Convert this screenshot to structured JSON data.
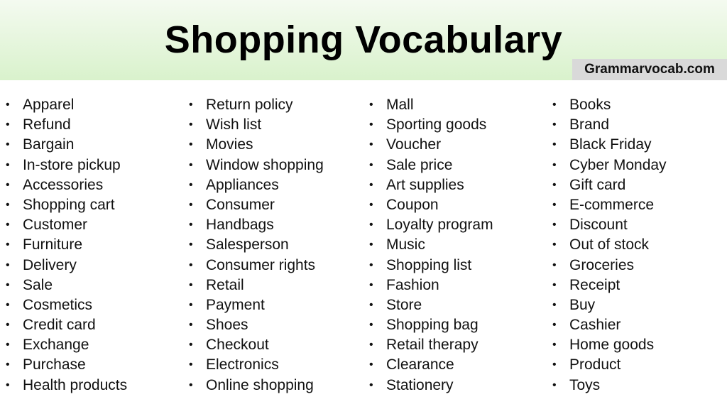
{
  "header": {
    "title": "Shopping Vocabulary",
    "site": "Grammarvocab.com"
  },
  "columns": [
    [
      "Apparel",
      "Refund",
      "Bargain",
      "In-store pickup",
      "Accessories",
      "Shopping cart",
      "Customer",
      "Furniture",
      "Delivery",
      "Sale",
      "Cosmetics",
      "Credit card",
      "Exchange",
      "Purchase",
      "Health products"
    ],
    [
      "Return policy",
      "Wish list",
      "Movies",
      "Window shopping",
      "Appliances",
      "Consumer",
      "Handbags",
      "Salesperson",
      "Consumer rights",
      "Retail",
      "Payment",
      "Shoes",
      "Checkout",
      "Electronics",
      "Online shopping"
    ],
    [
      "Mall",
      "Sporting goods",
      "Voucher",
      "Sale price",
      "Art supplies",
      "Coupon",
      "Loyalty program",
      "Music",
      "Shopping list",
      "Fashion",
      "Store",
      "Shopping bag",
      "Retail therapy",
      "Clearance",
      "Stationery"
    ],
    [
      "Books",
      "Brand",
      "Black Friday",
      "Cyber Monday",
      "Gift card",
      "E-commerce",
      "Discount",
      "Out of stock",
      "Groceries",
      "Receipt",
      "Buy",
      "Cashier",
      "Home goods",
      "Product",
      "Toys"
    ]
  ],
  "bullet": "•"
}
